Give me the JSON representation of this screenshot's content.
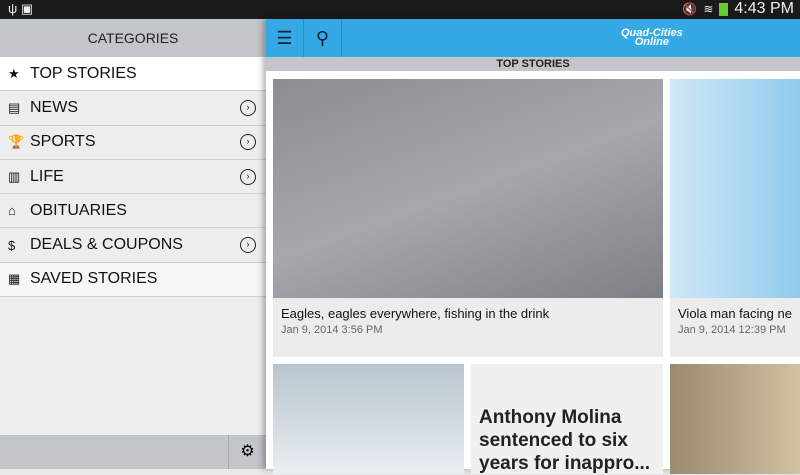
{
  "status": {
    "time": "4:43 PM"
  },
  "sidebar": {
    "title": "CATEGORIES",
    "items": [
      {
        "label": "TOP STORIES",
        "icon": "★"
      },
      {
        "label": "NEWS",
        "icon": "▤"
      },
      {
        "label": "SPORTS",
        "icon": "🏆"
      },
      {
        "label": "LIFE",
        "icon": "▥"
      },
      {
        "label": "OBITUARIES",
        "icon": "⌂"
      },
      {
        "label": "DEALS & COUPONS",
        "icon": "$"
      },
      {
        "label": "SAVED STORIES",
        "icon": "▦"
      }
    ]
  },
  "header": {
    "logo": "Quad-Cities Online",
    "section": "TOP STORIES"
  },
  "stories": [
    {
      "title": "Eagles, eagles everywhere, fishing in the drink",
      "date": "Jan 9, 2014 3:56 PM"
    },
    {
      "title": "Viola man facing ne",
      "date": "Jan 9, 2014 12:39 PM"
    },
    {
      "title": "Anthony Molina sentenced to six years for inappro..."
    }
  ]
}
